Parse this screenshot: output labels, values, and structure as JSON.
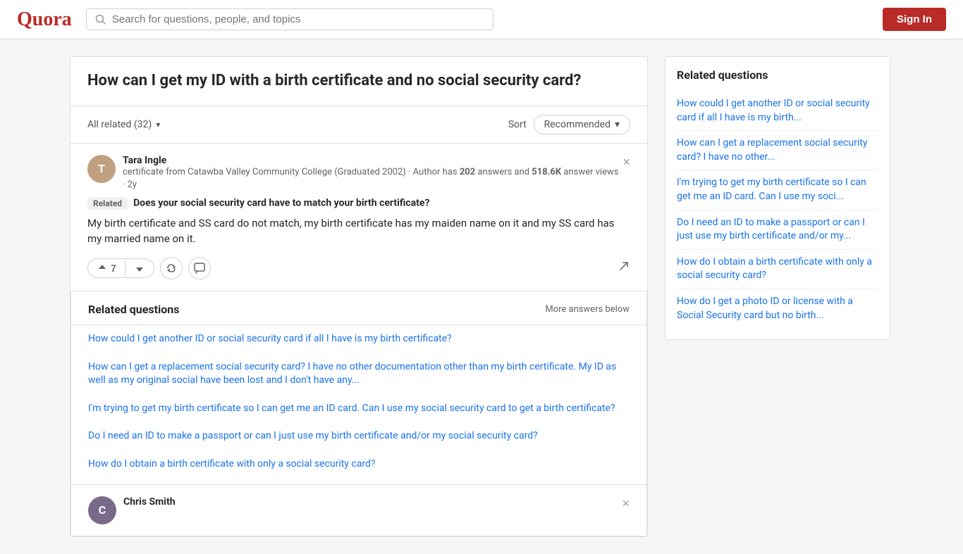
{
  "header": {
    "logo": "Quora",
    "search_placeholder": "Search for questions, people, and topics",
    "sign_in_label": "Sign In"
  },
  "question": {
    "title": "How can I get my ID with a birth certificate and no social security card?"
  },
  "filter_bar": {
    "all_related_label": "All related (32)",
    "sort_label": "Sort",
    "recommended_label": "Recommended"
  },
  "answer": {
    "author_name": "Tara Ingle",
    "author_bio": "certificate from Catawba Valley Community College (Graduated 2002) · Author has",
    "author_answers": "202",
    "author_bio2": "answers and",
    "author_views": "518.6K",
    "author_views2": "answer views · 2y",
    "related_tag": "Related",
    "related_question": "Does your social security card have to match your birth certificate?",
    "answer_body": "My birth certificate and SS card do not match, my birth certificate has my maiden name on it and my SS card has my married name on it.",
    "upvotes": "7"
  },
  "related_questions_section": {
    "title": "Related questions",
    "more_answers": "More answers below",
    "items": [
      "How could I get another ID or social security card if all I have is my birth certificate?",
      "How can I get a replacement social security card? I have no other documentation other than my birth certificate. My ID as well as my original social have been lost and I don't have any...",
      "I'm trying to get my birth certificate so I can get me an ID card. Can I use my social security card to get a birth certificate?",
      "Do I need an ID to make a passport or can I just use my birth certificate and/or my social security card?",
      "How do I obtain a birth certificate with only a social security card?"
    ]
  },
  "second_author": {
    "name": "Chris Smith"
  },
  "sidebar": {
    "title": "Related questions",
    "items": [
      "How could I get another ID or social security card if all I have is my birth...",
      "How can I get a replacement social security card? I have no other...",
      "I'm trying to get my birth certificate so I can get me an ID card. Can I use my soci...",
      "Do I need an ID to make a passport or can I just use my birth certificate and/or my...",
      "How do I obtain a birth certificate with only a social security card?",
      "How do I get a photo ID or license with a Social Security card but no birth..."
    ]
  },
  "icons": {
    "search": "🔍",
    "chevron_down": "▾",
    "close": "×",
    "share": "↗",
    "comment": "💬",
    "refresh": "↺"
  }
}
